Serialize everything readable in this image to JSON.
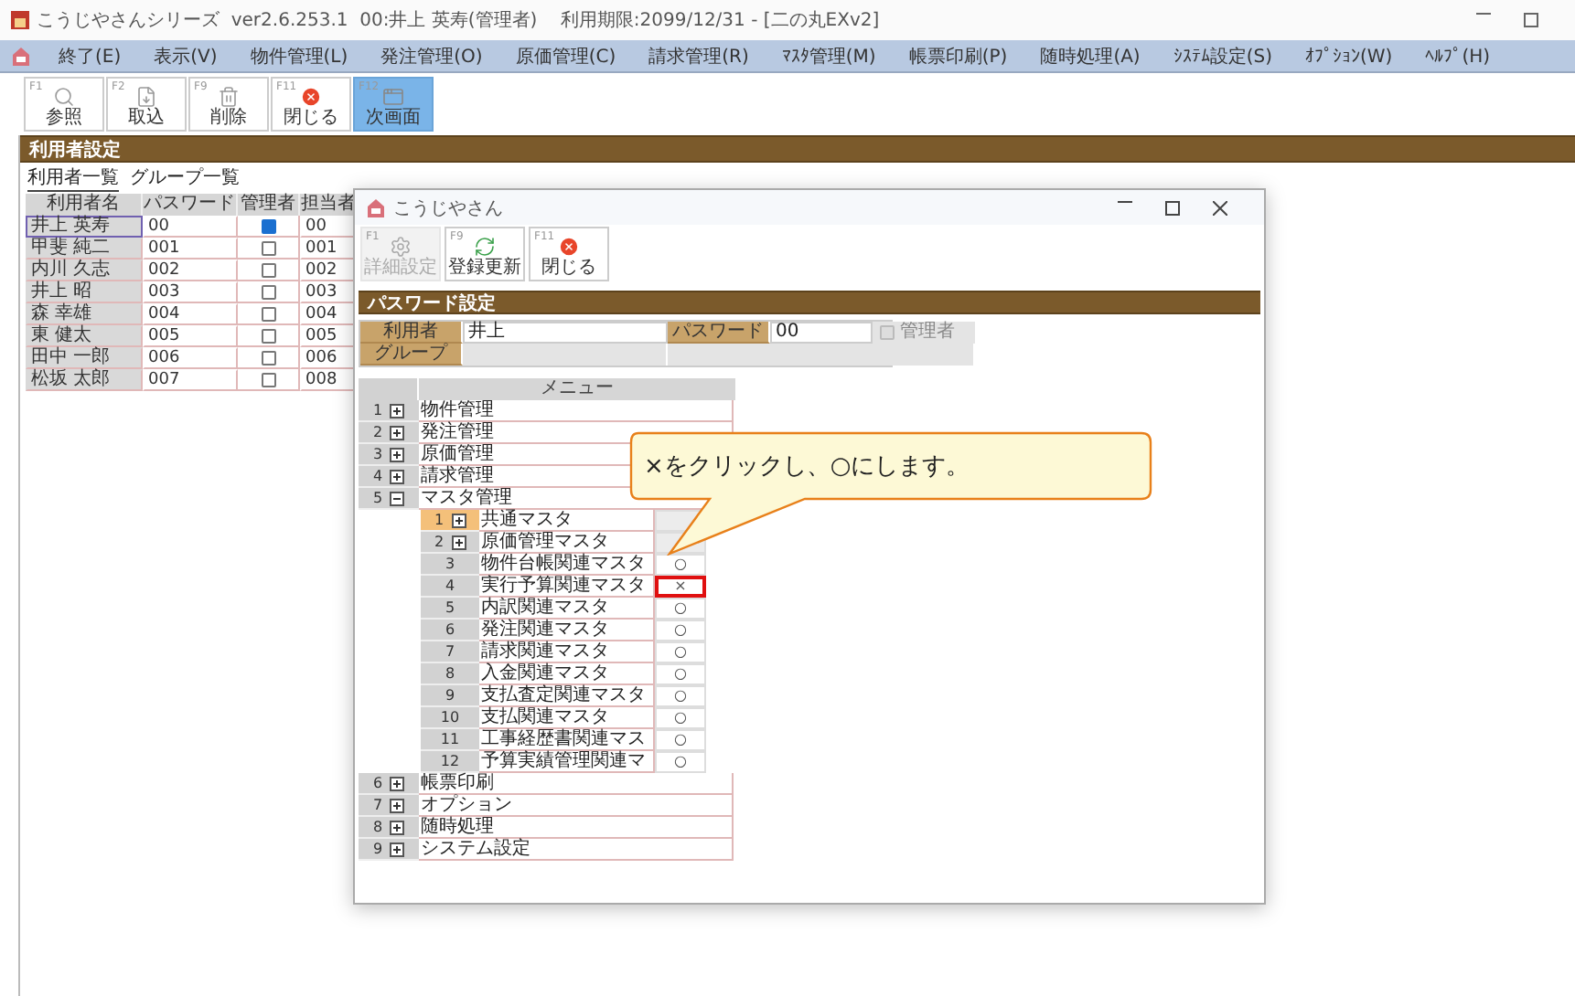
{
  "window": {
    "title": "こうじやさんシリーズ  ver2.6.253.1  00:井上 英寿(管理者)    利用期限:2099/12/31 - [二の丸EXv2]"
  },
  "menu": [
    "終了(E)",
    "表示(V)",
    "物件管理(L)",
    "発注管理(O)",
    "原価管理(C)",
    "請求管理(R)",
    "ﾏｽﾀ管理(M)",
    "帳票印刷(P)",
    "随時処理(A)",
    "ｼｽﾃﾑ設定(S)",
    "ｵﾌﾟｼｮﾝ(W)",
    "ﾍﾙﾌﾟ(H)"
  ],
  "toolbar": [
    {
      "key": "F1",
      "label": "参照",
      "kind": "search",
      "selected": false
    },
    {
      "key": "F2",
      "label": "取込",
      "kind": "import",
      "selected": false
    },
    {
      "key": "F9",
      "label": "削除",
      "kind": "delete",
      "selected": false
    },
    {
      "key": "F11",
      "label": "閉じる",
      "kind": "close",
      "selected": false
    },
    {
      "key": "F12",
      "label": "次画面",
      "kind": "next",
      "selected": true
    }
  ],
  "section_title": "利用者設定",
  "tabs": [
    {
      "label": "利用者一覧",
      "selected": true
    },
    {
      "label": "グループ一覧",
      "selected": false
    }
  ],
  "user_table": {
    "columns": [
      "利用者名",
      "パスワード",
      "管理者",
      "担当者"
    ],
    "rows": [
      {
        "name": "井上 英寿",
        "password": "00",
        "admin": true,
        "staff": "00",
        "selected": true
      },
      {
        "name": "甲斐 純二",
        "password": "001",
        "admin": false,
        "staff": "001",
        "selected": false
      },
      {
        "name": "内川 久志",
        "password": "002",
        "admin": false,
        "staff": "002",
        "selected": false
      },
      {
        "name": "井上 昭",
        "password": "003",
        "admin": false,
        "staff": "003",
        "selected": false
      },
      {
        "name": "森 幸雄",
        "password": "004",
        "admin": false,
        "staff": "004",
        "selected": false
      },
      {
        "name": "東 健太",
        "password": "005",
        "admin": false,
        "staff": "005",
        "selected": false
      },
      {
        "name": "田中 一郎",
        "password": "006",
        "admin": false,
        "staff": "006",
        "selected": false
      },
      {
        "name": "松坂 太郎",
        "password": "007",
        "admin": false,
        "staff": "008",
        "selected": false
      }
    ]
  },
  "dialog": {
    "title": "こうじやさん",
    "toolbar": [
      {
        "key": "F1",
        "label": "詳細設定",
        "kind": "settings",
        "disabled": true
      },
      {
        "key": "F9",
        "label": "登録更新",
        "kind": "refresh",
        "disabled": false
      },
      {
        "key": "F11",
        "label": "閉じる",
        "kind": "close",
        "disabled": false
      }
    ],
    "section_title": "パスワード設定",
    "form": {
      "user_label": "利用者",
      "user_value": "井上",
      "password_label": "パスワード",
      "password_value": "00",
      "admin_label": "管理者",
      "admin_checked": false,
      "admin_disabled": true,
      "group_label": "グループ"
    },
    "menu_header": "メニュー",
    "menu_tree": [
      {
        "number": "1",
        "name": "物件管理",
        "expanded": false
      },
      {
        "number": "2",
        "name": "発注管理",
        "expanded": false
      },
      {
        "number": "3",
        "name": "原価管理",
        "expanded": false
      },
      {
        "number": "4",
        "name": "請求管理",
        "expanded": false
      },
      {
        "number": "5",
        "name": "マスタ管理",
        "expanded": true,
        "children": [
          {
            "kind": "group",
            "number": "1",
            "name": "共通マスタ",
            "expanded": false,
            "selected": true
          },
          {
            "kind": "group",
            "number": "2",
            "name": "原価管理マスタ",
            "expanded": false,
            "selected": false
          },
          {
            "kind": "leaf",
            "number": "3",
            "name": "物件台帳関連マスタ",
            "mark": "○",
            "highlighted": false,
            "selected": false
          },
          {
            "kind": "leaf",
            "number": "4",
            "name": "実行予算関連マスタ",
            "mark": "×",
            "highlighted": true,
            "selected": false
          },
          {
            "kind": "leaf",
            "number": "5",
            "name": "内訳関連マスタ",
            "mark": "○",
            "highlighted": false,
            "selected": false
          },
          {
            "kind": "leaf",
            "number": "6",
            "name": "発注関連マスタ",
            "mark": "○",
            "highlighted": false,
            "selected": false
          },
          {
            "kind": "leaf",
            "number": "7",
            "name": "請求関連マスタ",
            "mark": "○",
            "highlighted": false,
            "selected": false
          },
          {
            "kind": "leaf",
            "number": "8",
            "name": "入金関連マスタ",
            "mark": "○",
            "highlighted": false,
            "selected": false
          },
          {
            "kind": "leaf",
            "number": "9",
            "name": "支払査定関連マスタ",
            "mark": "○",
            "highlighted": false,
            "selected": false
          },
          {
            "kind": "leaf",
            "number": "10",
            "name": "支払関連マスタ",
            "mark": "○",
            "highlighted": false,
            "selected": false
          },
          {
            "kind": "leaf",
            "number": "11",
            "name": "工事経歴書関連マス",
            "mark": "○",
            "highlighted": false,
            "selected": false
          },
          {
            "kind": "leaf",
            "number": "12",
            "name": "予算実績管理関連マ",
            "mark": "○",
            "highlighted": false,
            "selected": false
          }
        ]
      },
      {
        "number": "6",
        "name": "帳票印刷",
        "expanded": false
      },
      {
        "number": "7",
        "name": "オプション",
        "expanded": false
      },
      {
        "number": "8",
        "name": "随時処理",
        "expanded": false
      },
      {
        "number": "9",
        "name": "システム設定",
        "expanded": false
      }
    ]
  },
  "callout": {
    "text": "×をクリックし、○にします。"
  }
}
